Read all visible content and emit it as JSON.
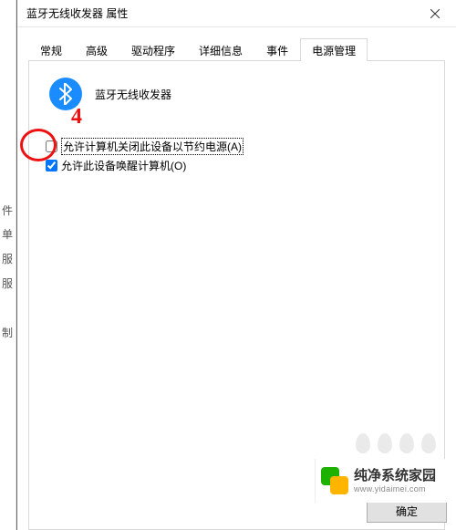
{
  "window": {
    "title": "蓝牙无线收发器 属性"
  },
  "tabs": [
    {
      "label": "常规"
    },
    {
      "label": "高级"
    },
    {
      "label": "驱动程序"
    },
    {
      "label": "详细信息"
    },
    {
      "label": "事件"
    },
    {
      "label": "电源管理"
    }
  ],
  "active_tab_index": 5,
  "device": {
    "name": "蓝牙无线收发器",
    "icon": "bluetooth-icon"
  },
  "checkboxes": {
    "allow_off": {
      "label": "允许计算机关闭此设备以节约电源(A)",
      "checked": false
    },
    "allow_wake": {
      "label": "允许此设备唤醒计算机(O)",
      "checked": true
    }
  },
  "buttons": {
    "ok": "确定"
  },
  "annotation": {
    "number": "4",
    "color": "#e11"
  },
  "left_fragments": [
    "件",
    "单",
    "服",
    "服",
    "制"
  ],
  "watermark": {
    "name": "纯净系统家园",
    "url": "www.yidaimei.com"
  }
}
